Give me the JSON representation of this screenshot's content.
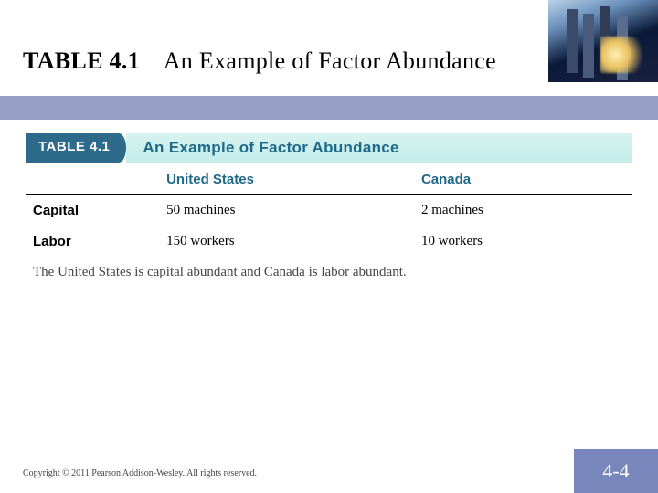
{
  "slide": {
    "title_label": "TABLE 4.1",
    "title_text": "An Example of Factor Abundance",
    "copyright": "Copyright © 2011 Pearson Addison-Wesley. All rights reserved.",
    "page_number": "4-4"
  },
  "table": {
    "badge": "TABLE 4.1",
    "title": "An Example of Factor Abundance",
    "columns": [
      "",
      "United States",
      "Canada"
    ],
    "rows": [
      {
        "label": "Capital",
        "cells": [
          "50 machines",
          "2 machines"
        ]
      },
      {
        "label": "Labor",
        "cells": [
          "150 workers",
          "10 workers"
        ]
      }
    ],
    "caption": "The United States is capital abundant and Canada is labor abundant."
  },
  "chart_data": {
    "type": "table",
    "title": "An Example of Factor Abundance",
    "columns": [
      "United States",
      "Canada"
    ],
    "rows": [
      "Capital",
      "Labor"
    ],
    "values": [
      [
        50,
        2
      ],
      [
        150,
        10
      ]
    ],
    "units": [
      "machines",
      "workers"
    ],
    "note": "The United States is capital abundant and Canada is labor abundant."
  }
}
